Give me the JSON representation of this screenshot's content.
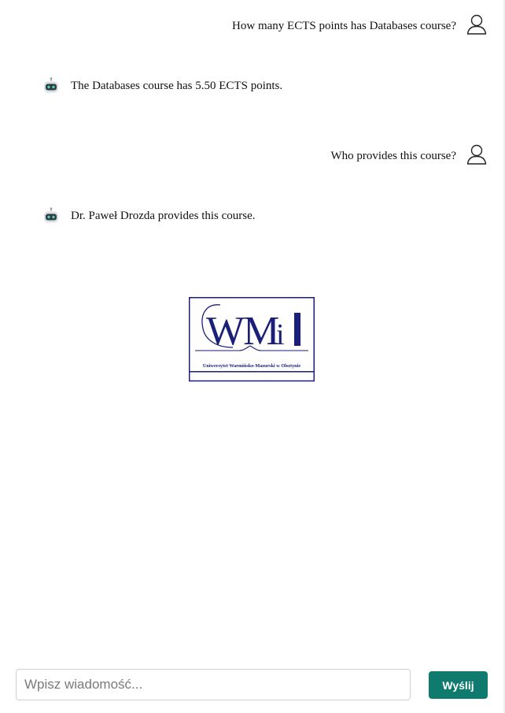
{
  "messages": [
    {
      "role": "user",
      "text": "How many ECTS points has Databases course?"
    },
    {
      "role": "bot",
      "text": "The Databases course has 5.50 ECTS points."
    },
    {
      "role": "user",
      "text": "Who provides this course?"
    },
    {
      "role": "bot",
      "text": "Dr. Paweł Drozda provides this course."
    }
  ],
  "logo": {
    "text": "WMiI",
    "subtitle": "Uniwersytet Warmińsko-Mazurski w Olsztynie",
    "color": "#1a1f7a"
  },
  "composer": {
    "placeholder": "Wpisz wiadomość...",
    "send_label": "Wyślij",
    "send_color": "#0f7a6e"
  },
  "icons": {
    "user_avatar": "user-outline-icon",
    "bot_avatar": "robot-icon"
  }
}
